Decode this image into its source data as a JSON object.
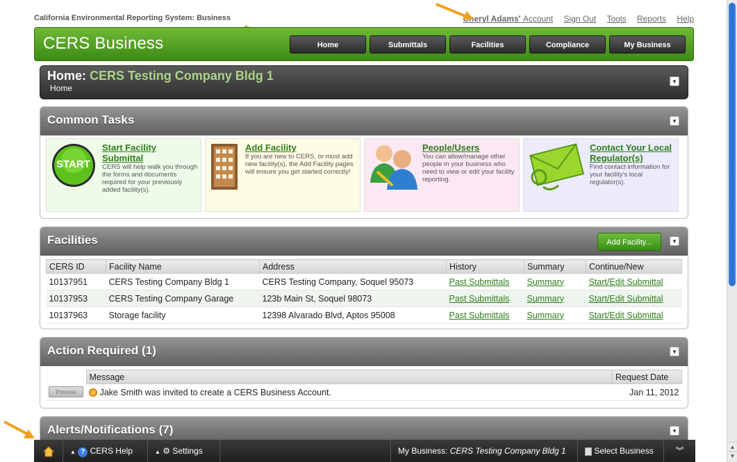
{
  "system_title": "California Environmental Reporting System: Business",
  "top_links": {
    "user_name": "Cheryl Adams'",
    "account": "Account",
    "sign_out": "Sign Out",
    "tools": "Tools",
    "reports": "Reports",
    "help": "Help"
  },
  "header": {
    "logo": "CERS Business",
    "nav": [
      "Home",
      "Submittals",
      "Facilities",
      "Compliance",
      "My Business"
    ]
  },
  "home_panel": {
    "title_prefix": "Home:",
    "company": "CERS Testing Company Bldg 1",
    "breadcrumb": "Home"
  },
  "common_tasks": {
    "title": "Common Tasks",
    "cards": [
      {
        "title_line1": "Start Facility",
        "title_line2": "Submittal",
        "desc": "CERS will help walk you through the forms and documents required for your previously added facility(s).",
        "icon_label": "START",
        "bg": "#eefbe8"
      },
      {
        "title_line1": "Add Facility",
        "title_line2": "",
        "desc": "If you are new to CERS, or must add new facility(s), the Add Facility pages will ensure you get started correctly!",
        "bg": "#fdfbe3"
      },
      {
        "title_line1": "People/Users",
        "title_line2": "",
        "desc": "You can allow/manage other people in your business who need to view or edit your facility reporting.",
        "bg": "#fbe8f3"
      },
      {
        "title_line1": "Contact Your Local",
        "title_line2": "Regulator(s)",
        "desc": "Find contact information for your facility's local regulator(s).",
        "bg": "#ecebfb"
      }
    ]
  },
  "facilities": {
    "title": "Facilities",
    "add_button": "Add Facility...",
    "columns": [
      "CERS ID",
      "Facility Name",
      "Address",
      "History",
      "Summary",
      "Continue/New"
    ],
    "rows": [
      {
        "id": "10137951",
        "name": "CERS Testing Company Bldg 1",
        "address": "CERS Testing Company, Soquel 95073",
        "history": "Past Submittals",
        "summary": "Summary",
        "action": "Start/Edit Submittal"
      },
      {
        "id": "10137953",
        "name": "CERS Testing Company Garage",
        "address": "123b Main St, Soquel 98073",
        "history": "Past Submittals",
        "summary": "Summary",
        "action": "Start/Edit Submittal"
      },
      {
        "id": "10137963",
        "name": "Storage facility",
        "address": "12398 Alvarado Blvd, Aptos 95008",
        "history": "Past Submittals",
        "summary": "Summary",
        "action": "Start/Edit Submittal"
      }
    ]
  },
  "action_required": {
    "title": "Action Required (1)",
    "columns": [
      "Message",
      "Request Date"
    ],
    "rows": [
      {
        "button": "Process",
        "message": "Jake Smith was invited to create a CERS Business Account.",
        "date": "Jan 11, 2012"
      }
    ]
  },
  "alerts": {
    "title": "Alerts/Notifications (7)"
  },
  "bottom_bar": {
    "cers_help": "CERS Help",
    "settings": "Settings",
    "my_business_label": "My Business:",
    "my_business_value": "CERS Testing Company Bldg 1",
    "select_business": "Select Business"
  },
  "colors": {
    "brand_green": "#4a9e1f",
    "link_green": "#2e7d1a",
    "annotation_orange": "#f0a020"
  }
}
